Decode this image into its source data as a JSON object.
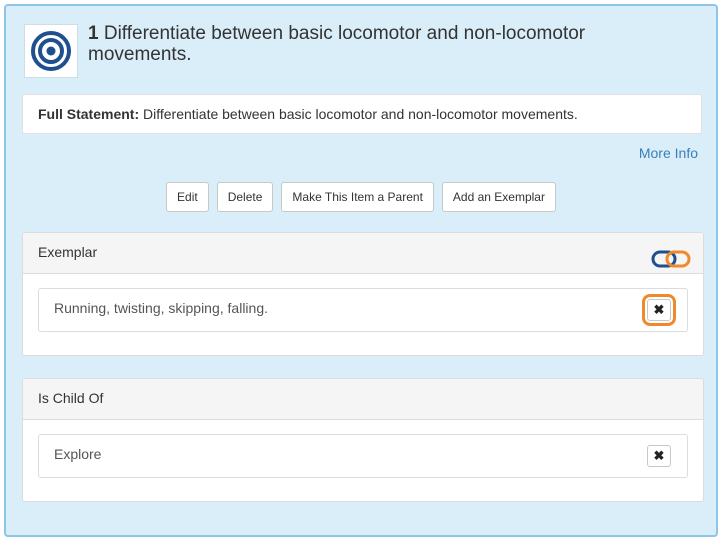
{
  "header": {
    "number": "1",
    "title": "Differentiate between basic locomotor and non-locomotor movements."
  },
  "statement": {
    "label": "Full Statement:",
    "text": "Differentiate between basic locomotor and non-locomotor movements."
  },
  "more_info": "More Info",
  "actions": {
    "edit": "Edit",
    "delete": "Delete",
    "make_parent": "Make This Item a Parent",
    "add_exemplar": "Add an Exemplar"
  },
  "exemplar": {
    "title": "Exemplar",
    "item_text": "Running, twisting, skipping, falling.",
    "remove_icon": "✖"
  },
  "child_of": {
    "title": "Is Child Of",
    "item_text": "Explore",
    "remove_icon": "✖"
  },
  "colors": {
    "panel_bg": "#d9eef9",
    "link": "#3a7fb9",
    "focus_outline": "#f0892b",
    "logo_blue": "#1f4f8f"
  },
  "icons": {
    "logo": "target-icon",
    "link": "chain-link-icon",
    "remove": "close-icon"
  }
}
